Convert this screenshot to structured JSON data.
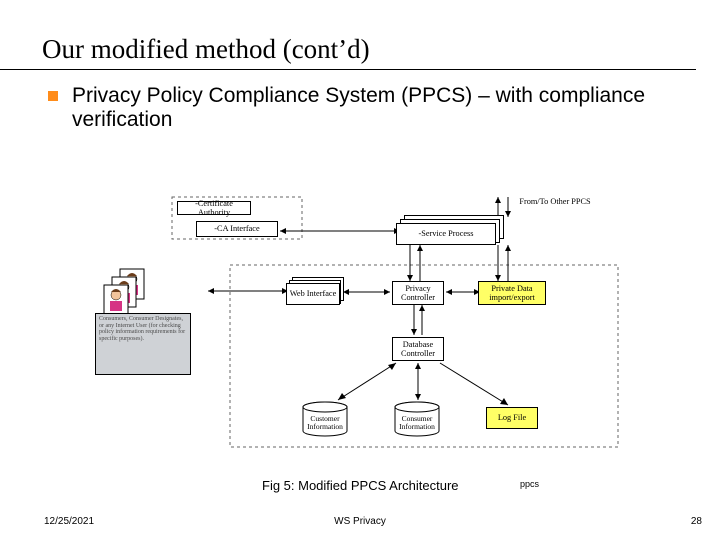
{
  "slide": {
    "title": "Our modified method (cont’d)",
    "subtitle": "Privacy Policy Compliance System (PPCS) – with compliance verification"
  },
  "diagram": {
    "nodes": {
      "cert_authority": "-Certificate Authority",
      "ca_interface": "-CA Interface",
      "service_process": "-Service Process",
      "from_to_other": "From/To Other PPCS",
      "web_interface": "Web Interface",
      "privacy_controller": "Privacy Controller",
      "private_data_io": "Private Data import/export",
      "database_controller": "Database Controller",
      "customer_info": "Customer Information",
      "consumer_info": "Consumer Information",
      "log_file": "Log File",
      "consumer_card": "Consumers, Consumer Designates, or any Internet User (for checking policy information requirements for specific purposes)."
    },
    "caption": "Fig 5: Modified PPCS Architecture",
    "ppcs_label": "ppcs"
  },
  "footer": {
    "date": "12/25/2021",
    "center": "WS Privacy",
    "page": "28"
  }
}
